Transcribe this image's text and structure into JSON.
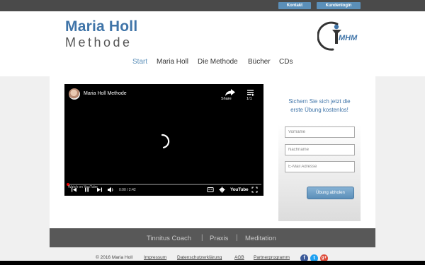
{
  "topbar": {
    "contact_label": "Kontakt",
    "login_label": "Kundenlogin"
  },
  "brand": {
    "title": "Maria Holl",
    "subtitle": "Methode",
    "logo_text": "MHM"
  },
  "nav": {
    "items": [
      {
        "label": "Start",
        "active": true
      },
      {
        "label": "Maria Holl",
        "active": false
      },
      {
        "label": "Die Methode",
        "active": false
      },
      {
        "label": "Bücher",
        "active": false
      },
      {
        "label": "CDs",
        "active": false
      }
    ]
  },
  "video": {
    "title": "Maria Holl Methode",
    "share_label": "Share",
    "playlist_count": "1/1",
    "watch_label": "Watch on",
    "time": "0:00 / 2:42",
    "youtube_label": "YouTube"
  },
  "signup": {
    "title": "Sichern Sie sich jetzt die erste Übung kostenlos!",
    "firstname_placeholder": "Vorname",
    "lastname_placeholder": "Nachname",
    "email_placeholder": "E-Mail Adresse",
    "submit_label": "Übung abholen"
  },
  "footer_nav": {
    "items": [
      "Tinnitus Coach",
      "Praxis",
      "Meditation"
    ],
    "separator": "|"
  },
  "bottom": {
    "copyright": "© 2016 Maria Holl",
    "links": [
      "Impressum",
      "Datenschutzerklärung",
      "AGB",
      "Partnerprogramm"
    ]
  },
  "colors": {
    "accent": "#5b8fb9",
    "brand_blue": "#3f74a8",
    "footer_band": "#585858",
    "facebook": "#3b5998",
    "twitter": "#1da1f2",
    "googleplus": "#dd4b39"
  },
  "social": {
    "facebook_glyph": "f",
    "twitter_glyph": "t",
    "googleplus_glyph": "g+"
  }
}
